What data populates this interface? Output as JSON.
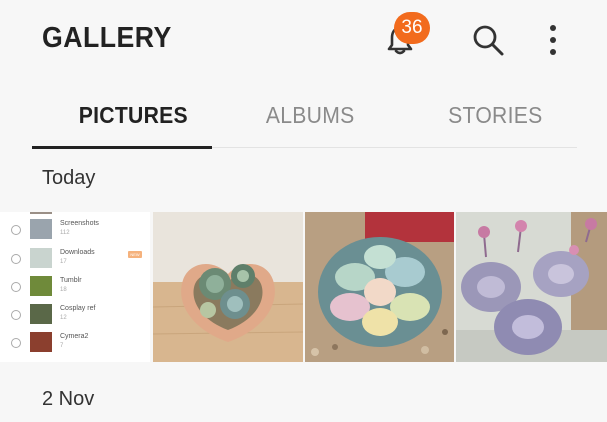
{
  "header": {
    "title": "GALLERY",
    "notification_count": "36",
    "icons": {
      "bell": "bell-icon",
      "search": "search-icon",
      "more": "more-vertical-icon"
    },
    "badge_color": "#f26b1d"
  },
  "tabs": [
    {
      "label": "PICTURES",
      "active": true
    },
    {
      "label": "ALBUMS",
      "active": false
    },
    {
      "label": "STORIES",
      "active": false
    }
  ],
  "sections": [
    {
      "label": "Today"
    },
    {
      "label": "2 Nov"
    }
  ],
  "albums_screenshot": {
    "rows": [
      {
        "name": "Screenshots",
        "count": "112"
      },
      {
        "name": "Downloads",
        "count": "17",
        "badge": "NEW"
      },
      {
        "name": "Tumblr",
        "count": "18"
      },
      {
        "name": "Cosplay ref",
        "count": "12"
      },
      {
        "name": "Cymera2",
        "count": "7"
      }
    ]
  }
}
